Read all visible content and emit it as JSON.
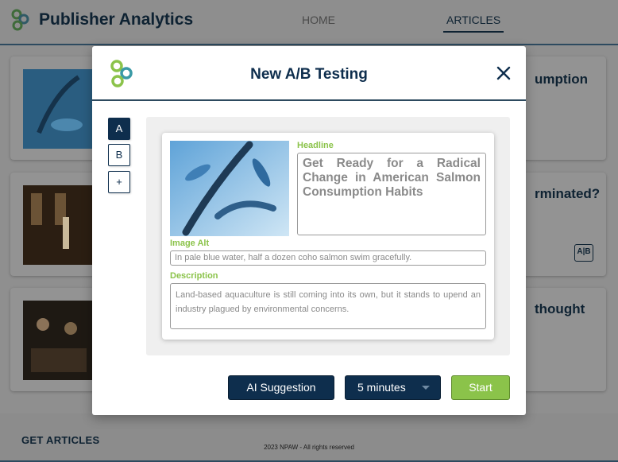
{
  "app": {
    "title": "Publisher Analytics",
    "nav": {
      "home": "HOME",
      "articles": "ARTICLES"
    }
  },
  "background_cards": [
    {
      "title_peek": "umption"
    },
    {
      "title_peek": "rminated?"
    },
    {
      "title_peek": "thought"
    }
  ],
  "footer": {
    "get_articles": "GET ARTICLES",
    "copyright": "2023 NPAW - All rights reserved"
  },
  "modal": {
    "title": "New A/B Testing",
    "variants": [
      "A",
      "B",
      "+"
    ],
    "active_variant": "A",
    "headline_label": "Headline",
    "headline": "Get Ready for a Radical Change in American Salmon Consumption Habits",
    "image_alt_label": "Image Alt",
    "image_alt": "In pale blue water, half a dozen coho salmon swim gracefully.",
    "description_label": "Description",
    "description": "Land-based aquaculture is still coming into its own, but it stands to upend an industry plagued by environmental concerns.",
    "ai_button": "AI Suggestion",
    "duration": "5 minutes",
    "start_button": "Start"
  },
  "colors": {
    "navy": "#0e2e4d",
    "accent_green": "#8bc34a",
    "overlay_gray": "#8f8f8f"
  },
  "icons": {
    "logo": "linked-circles-logo",
    "close": "close-icon",
    "ab_compare": "ab-compare-icon",
    "dropdown": "chevron-down-icon"
  }
}
